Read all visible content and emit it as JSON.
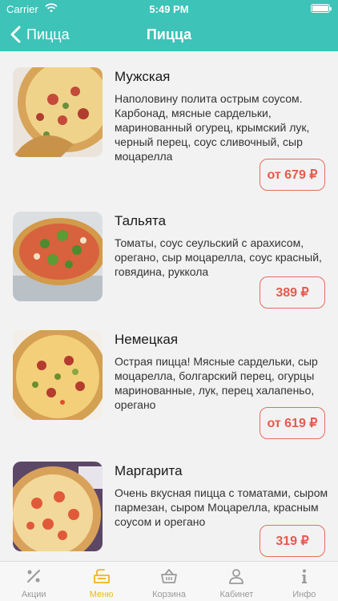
{
  "status_bar": {
    "carrier": "Carrier",
    "time": "5:49 PM"
  },
  "nav": {
    "back_label": "Пицца",
    "title": "Пицца"
  },
  "items": [
    {
      "name": "Мужская",
      "description": "Наполовину полита острым соусом. Карбонад, мясные сардельки, маринованный огурец, крымский лук, черный перец, соус сливочный, сыр моцарелла",
      "price": "от 679 ₽"
    },
    {
      "name": "Тальята",
      "description": "Томаты, соус сеульский с арахисом, орегано, сыр моцарелла, соус красный, говядина, руккола",
      "price": "389 ₽"
    },
    {
      "name": "Немецкая",
      "description": "Острая пицца! Мясные сардельки, сыр моцарелла, болгарский перец, огурцы маринованные, лук, перец халапеньо, орегано",
      "price": "от 619 ₽"
    },
    {
      "name": "Маргарита",
      "description": "Очень вкусная пицца с томатами, сыром пармезан, сыром Моцарелла, красным соусом и орегано",
      "price": "319 ₽"
    }
  ],
  "tabbar": {
    "items": [
      {
        "label": "Акции",
        "icon": "percent-icon"
      },
      {
        "label": "Меню",
        "icon": "menu-bag-icon"
      },
      {
        "label": "Корзина",
        "icon": "basket-icon"
      },
      {
        "label": "Кабинет",
        "icon": "user-icon"
      },
      {
        "label": "Инфо",
        "icon": "info-icon"
      }
    ],
    "active_color": "#f1b51c",
    "inactive_color": "#9a9a9a"
  },
  "colors": {
    "header": "#3dc3b8",
    "price_border": "#e66c60",
    "background": "#f2f2f2"
  }
}
